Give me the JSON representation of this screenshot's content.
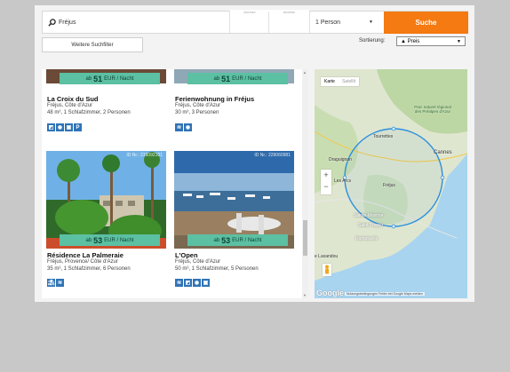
{
  "search": {
    "location_value": "Fréjus",
    "date_label_1": "Anreise",
    "date_label_2": "Abreise",
    "persons_value": "1 Person",
    "button_label": "Suche"
  },
  "filter_button": "Weitere Suchfilter",
  "sort": {
    "label": "Sortierung:",
    "value": "▲ Preis"
  },
  "listings": [
    {
      "price_prefix": "ab",
      "price_value": "51",
      "price_unit": "EUR / Nacht",
      "title": "La Croix du Sud",
      "location": "Fréjus, Côte d'Azur",
      "details": "48 m², 1 Schlafzimmer, 2 Personen",
      "icons": [
        "wheelchair-pool-icon",
        "washer-icon",
        "tv-icon",
        "parking-icon"
      ],
      "icon_glyphs": [
        "◩",
        "◉",
        "▣",
        "P"
      ]
    },
    {
      "price_prefix": "ab",
      "price_value": "51",
      "price_unit": "EUR / Nacht",
      "title": "Ferienwohnung in Fréjus",
      "location": "Fréjus, Côte d'Azur",
      "details": "30 m², 3 Personen",
      "icons": [
        "pool-icon",
        "washer-icon"
      ],
      "icon_glyphs": [
        "≋",
        "◉"
      ]
    },
    {
      "id_label": "ID Nr.: 219092101",
      "price_prefix": "ab",
      "price_value": "53",
      "price_unit": "EUR / Nacht",
      "title": "Résidence La Palmeraie",
      "location": "Fréjus, Provence/ Côte d'Azur",
      "details": "35 m², 1 Schlafzimmer, 6 Personen",
      "icons": [
        "beach-icon",
        "pool-icon"
      ],
      "icon_glyphs": [
        "⛱",
        "≋"
      ]
    },
    {
      "id_label": "ID Nr.: 229060981",
      "price_prefix": "ab",
      "price_value": "53",
      "price_unit": "EUR / Nacht",
      "title": "L'Open",
      "location": "Fréjus, Côte d'Azur",
      "details": "50 m², 1 Schlafzimmer, 5 Personen",
      "icons": [
        "pool-icon",
        "wheelchair-icon",
        "washer-icon",
        "tv-icon"
      ],
      "icon_glyphs": [
        "≋",
        "◩",
        "◉",
        "▣"
      ]
    }
  ],
  "map": {
    "type_map": "Karte",
    "type_satellite": "Satellit",
    "labels": {
      "parc": "Parc naturel régional des Préalpes d'Azur",
      "tourrettes": "Tourrettes",
      "cannes": "Cannes",
      "draguignan": "Draguignan",
      "les_arcs": "Les Arcs",
      "frejus": "Fréjus",
      "sainte_maxime": "Sainte-Maxime",
      "saint_tropez": "Saint-Tropez",
      "ramatuelle": "Ramatuelle",
      "lavandou": "e Lavandou"
    },
    "google": "Google",
    "terms": "Nutzungsbedingungen   Fehler bei Google Maps melden",
    "zoom_in": "+",
    "zoom_out": "−"
  },
  "colors": {
    "accent": "#f47a11",
    "price_badge": "#5cc0a3",
    "amenity_icon": "#2f73b6",
    "radius_circle": "#2b8fe0"
  }
}
